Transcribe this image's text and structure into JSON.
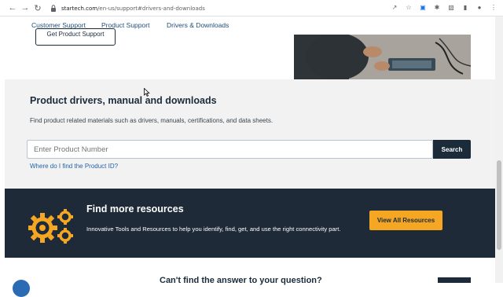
{
  "browser": {
    "url_host": "startech.com",
    "url_path": "/en-us/support#drivers-and-downloads"
  },
  "subnav": {
    "items": [
      {
        "label": "Customer Support"
      },
      {
        "label": "Product Support"
      },
      {
        "label": "Drivers & Downloads"
      }
    ]
  },
  "hero": {
    "support_button": "Get Product Support"
  },
  "drivers": {
    "title": "Product drivers, manual and downloads",
    "description": "Find product related materials such as drivers, manuals, certifications, and data sheets.",
    "search_placeholder": "Enter Product Number",
    "search_button": "Search",
    "help_link": "Where do I find the Product ID?"
  },
  "resources": {
    "title": "Find more resources",
    "description": "Innovative Tools and Resources to help you identify, find, get, and use the right connectivity part.",
    "button": "View All Resources",
    "accent_color": "#f5a623"
  },
  "bottom": {
    "question": "Can't find the answer to your question?"
  }
}
